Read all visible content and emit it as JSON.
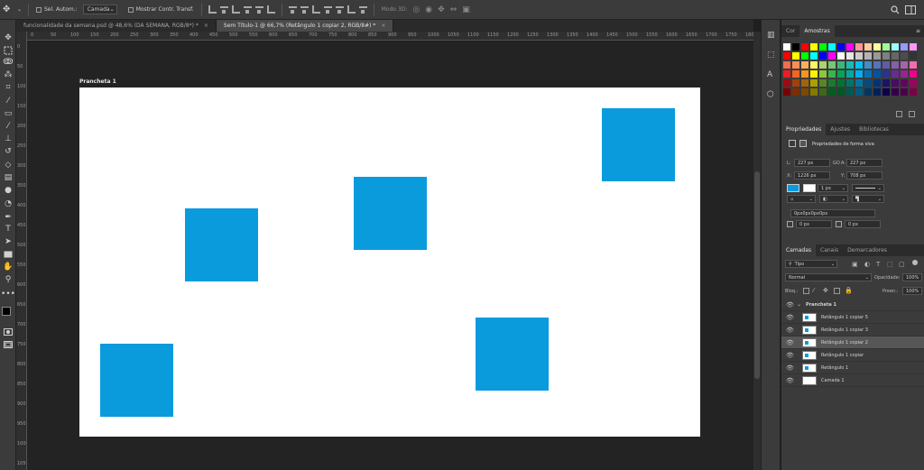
{
  "options_bar": {
    "auto_select_label": "Sel. Autom.:",
    "auto_select_target": "Camada",
    "transform_controls_label": "Mostrar Contr. Transf.",
    "mode_3d_label": "Modo 3D:"
  },
  "tabs": [
    {
      "label": "funcionalidade da semana.psd @ 48,6% (DA SEMANA, RGB/8*) *",
      "active": false
    },
    {
      "label": "Sem Título-1 @ 66,7% (Retângulo 1 copiar 2, RGB/8#) *",
      "active": true
    }
  ],
  "ruler": {
    "h_ticks": [
      "0",
      "50",
      "100",
      "150",
      "200",
      "250",
      "300",
      "350",
      "400",
      "450",
      "500",
      "550",
      "600",
      "650",
      "700",
      "750",
      "800",
      "850",
      "900",
      "950",
      "1000",
      "1050",
      "1100",
      "1150",
      "1200",
      "1250",
      "1300",
      "1350",
      "1400",
      "1450",
      "1500",
      "1550",
      "1600",
      "1650",
      "1700",
      "1750",
      "1800",
      "1850",
      "1900",
      "1950",
      "2000"
    ],
    "v_ticks": [
      "0",
      "50",
      "100",
      "150",
      "200",
      "250",
      "300",
      "350",
      "400",
      "450",
      "500",
      "550",
      "600",
      "650",
      "700",
      "750",
      "800",
      "850",
      "900",
      "950",
      "1000",
      "1050",
      "1100"
    ]
  },
  "artboard": {
    "label": "Prancheta 1",
    "shape_color": "#0a9bdd"
  },
  "color_panel": {
    "tabs": [
      "Cor",
      "Amostras"
    ],
    "active_tab": "Amostras",
    "swatches": [
      "#ffffff",
      "#000000",
      "#ff0000",
      "#ffff00",
      "#00ff00",
      "#00ffff",
      "#0000ff",
      "#ff00ff",
      "#ff9999",
      "#ffcc99",
      "#ffff99",
      "#99ff99",
      "#99ffff",
      "#9999ff",
      "#ff99ff",
      "#ff0000",
      "#ffff00",
      "#00ff00",
      "#00ffff",
      "#0000ff",
      "#ff00ff",
      "#ffffff",
      "#e6e6e6",
      "#cccccc",
      "#b3b3b3",
      "#999999",
      "#808080",
      "#666666",
      "#4d4d4d",
      "#333333",
      "#f26c4f",
      "#f68e55",
      "#fbaf5d",
      "#fff568",
      "#acd372",
      "#7cc576",
      "#3bb878",
      "#1abbb4",
      "#00bff3",
      "#438cca",
      "#5574b9",
      "#605ca8",
      "#855fa8",
      "#a763a8",
      "#f06eaa",
      "#ed1c24",
      "#f26522",
      "#f7941d",
      "#fff200",
      "#8dc63f",
      "#39b54a",
      "#00a651",
      "#00a99d",
      "#00aeef",
      "#0072bc",
      "#0054a6",
      "#2e3192",
      "#662d91",
      "#92278f",
      "#ec008c",
      "#9e0b0f",
      "#a0410d",
      "#a3620a",
      "#aba000",
      "#598527",
      "#1a7b30",
      "#007236",
      "#00746b",
      "#0076a3",
      "#004b80",
      "#003471",
      "#1b1464",
      "#440e62",
      "#630460",
      "#9e005d",
      "#790000",
      "#7b2e00",
      "#7d4900",
      "#827b00",
      "#406618",
      "#005e20",
      "#005826",
      "#005952",
      "#005b7f",
      "#003663",
      "#002157",
      "#0d004c",
      "#32004b",
      "#4b0049",
      "#7b0046"
    ]
  },
  "properties_panel": {
    "tabs": [
      "Propriedades",
      "Ajustes",
      "Bibliotecas"
    ],
    "active_tab": "Propriedades",
    "heading": "Propriedades de forma viva",
    "w_label": "L:",
    "w_value": "227 px",
    "link_label": "GO",
    "h_label": "A:",
    "h_value": "227 px",
    "x_label": "X:",
    "x_value": "1226 px",
    "y_label": "Y:",
    "y_value": "708 px",
    "stroke_width": "1 px",
    "corner_value": "0px0px0px0px",
    "corner_a": "0 px",
    "corner_b": "0 px"
  },
  "layers_panel": {
    "tabs": [
      "Camadas",
      "Canais",
      "Demarcadores"
    ],
    "active_tab": "Camadas",
    "filter_kind": "Tipo",
    "blend_mode": "Normal",
    "opacity_label": "Opacidade:",
    "opacity_value": "100%",
    "lock_label": "Bloq.:",
    "fill_label": "Preen.:",
    "fill_value": "100%",
    "group_name": "Prancheta 1",
    "layers": [
      {
        "name": "Retângulo 1 copiar 5",
        "type": "shape",
        "selected": false
      },
      {
        "name": "Retângulo 1 copiar 3",
        "type": "shape",
        "selected": false
      },
      {
        "name": "Retângulo 1 copiar 2",
        "type": "shape",
        "selected": true
      },
      {
        "name": "Retângulo 1 copiar",
        "type": "shape",
        "selected": false
      },
      {
        "name": "Retângulo 1",
        "type": "shape",
        "selected": false
      },
      {
        "name": "Camada 1",
        "type": "pixel",
        "selected": false
      }
    ]
  }
}
